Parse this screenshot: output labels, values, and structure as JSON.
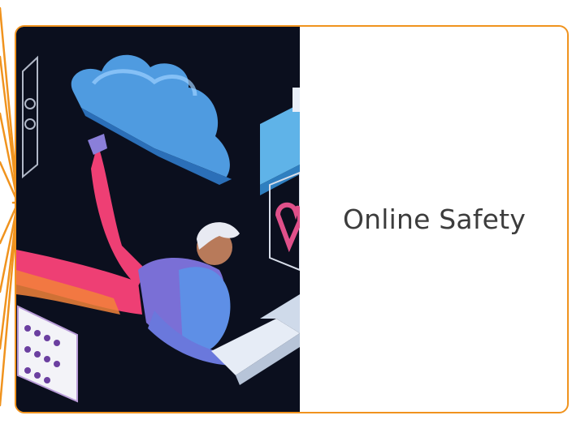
{
  "card": {
    "title": "Online Safety",
    "accent_color": "#f0931e",
    "image_icon": "online-safety-illustration"
  }
}
